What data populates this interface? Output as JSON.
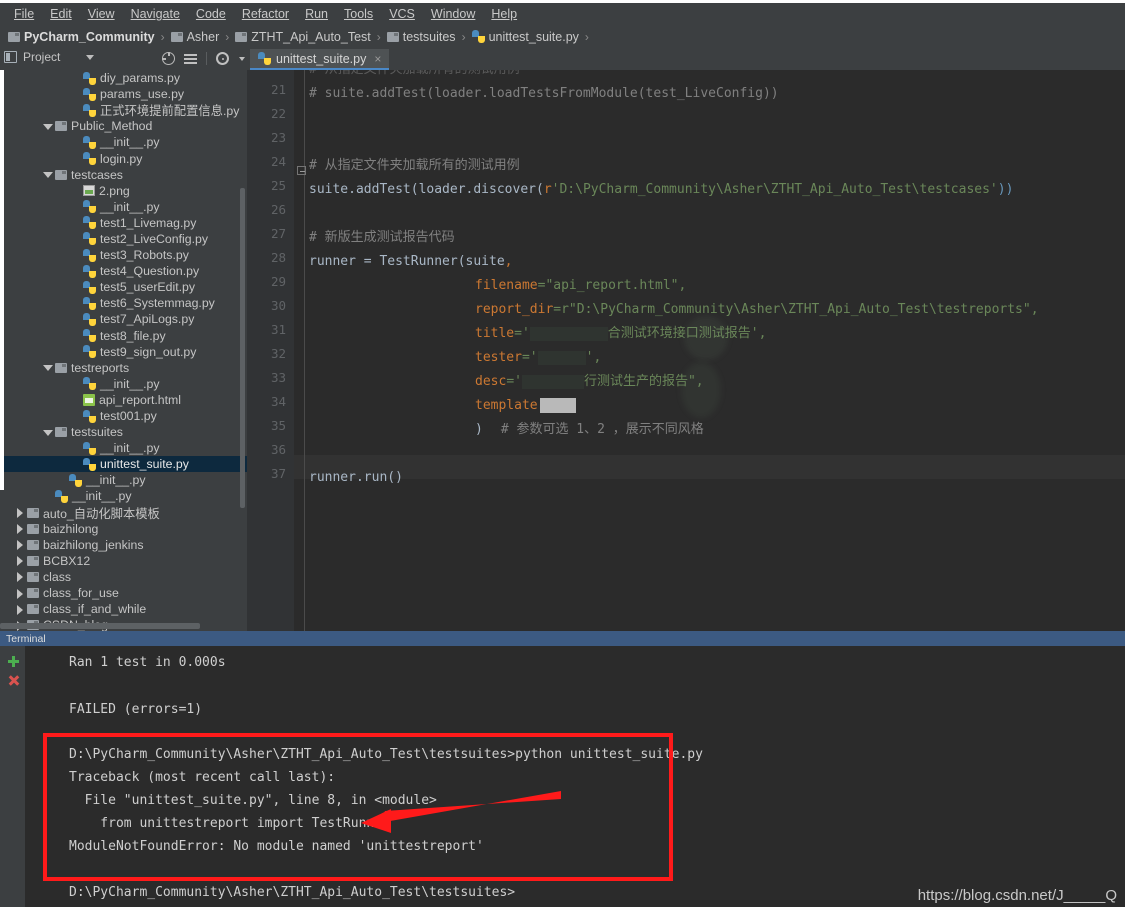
{
  "window": {
    "menu": [
      "File",
      "Edit",
      "View",
      "Navigate",
      "Code",
      "Refactor",
      "Run",
      "Tools",
      "VCS",
      "Window",
      "Help"
    ],
    "breadcrumb": [
      {
        "label": "PyCharm_Community",
        "icon": "folder-icon"
      },
      {
        "label": "Asher",
        "icon": "folder-icon"
      },
      {
        "label": "ZTHT_Api_Auto_Test",
        "icon": "folder-icon"
      },
      {
        "label": "testsuites",
        "icon": "folder-icon"
      },
      {
        "label": "unittest_suite.py",
        "icon": "python-file-icon"
      }
    ],
    "separator": "›"
  },
  "toolwindow": {
    "project_label": "Project",
    "icons": [
      "target-icon",
      "collapse-all-icon",
      "gear-icon",
      "hide-icon"
    ]
  },
  "editor_tab": {
    "label": "unittest_suite.py",
    "close": "×",
    "icon": "python-file-icon"
  },
  "tree": {
    "items": [
      {
        "label": "diy_params.py",
        "icon": "python-file-icon",
        "indent": 5,
        "arrow": "none",
        "selected": false
      },
      {
        "label": "params_use.py",
        "icon": "python-file-icon",
        "indent": 5,
        "arrow": "none",
        "selected": false
      },
      {
        "label": "正式环境提前配置信息.py",
        "icon": "python-file-icon",
        "indent": 5,
        "arrow": "none",
        "selected": false
      },
      {
        "label": "Public_Method",
        "icon": "folder-icon",
        "indent": 3,
        "arrow": "down",
        "selected": false
      },
      {
        "label": "__init__.py",
        "icon": "python-file-icon",
        "indent": 5,
        "arrow": "none",
        "selected": false
      },
      {
        "label": "login.py",
        "icon": "python-file-icon",
        "indent": 5,
        "arrow": "none",
        "selected": false
      },
      {
        "label": "testcases",
        "icon": "folder-icon",
        "indent": 3,
        "arrow": "down",
        "selected": false
      },
      {
        "label": "2.png",
        "icon": "image-file-icon",
        "indent": 5,
        "arrow": "none",
        "selected": false
      },
      {
        "label": "__init__.py",
        "icon": "python-file-icon",
        "indent": 5,
        "arrow": "none",
        "selected": false
      },
      {
        "label": "test1_Livemag.py",
        "icon": "python-file-icon",
        "indent": 5,
        "arrow": "none",
        "selected": false
      },
      {
        "label": "test2_LiveConfig.py",
        "icon": "python-file-icon",
        "indent": 5,
        "arrow": "none",
        "selected": false
      },
      {
        "label": "test3_Robots.py",
        "icon": "python-file-icon",
        "indent": 5,
        "arrow": "none",
        "selected": false
      },
      {
        "label": "test4_Question.py",
        "icon": "python-file-icon",
        "indent": 5,
        "arrow": "none",
        "selected": false
      },
      {
        "label": "test5_userEdit.py",
        "icon": "python-file-icon",
        "indent": 5,
        "arrow": "none",
        "selected": false
      },
      {
        "label": "test6_Systemmag.py",
        "icon": "python-file-icon",
        "indent": 5,
        "arrow": "none",
        "selected": false
      },
      {
        "label": "test7_ApiLogs.py",
        "icon": "python-file-icon",
        "indent": 5,
        "arrow": "none",
        "selected": false
      },
      {
        "label": "test8_file.py",
        "icon": "python-file-icon",
        "indent": 5,
        "arrow": "none",
        "selected": false
      },
      {
        "label": "test9_sign_out.py",
        "icon": "python-file-icon",
        "indent": 5,
        "arrow": "none",
        "selected": false
      },
      {
        "label": "testreports",
        "icon": "folder-icon",
        "indent": 3,
        "arrow": "down",
        "selected": false
      },
      {
        "label": "__init__.py",
        "icon": "python-file-icon",
        "indent": 5,
        "arrow": "none",
        "selected": false
      },
      {
        "label": "api_report.html",
        "icon": "html-file-icon",
        "indent": 5,
        "arrow": "none",
        "selected": false
      },
      {
        "label": "test001.py",
        "icon": "python-file-icon",
        "indent": 5,
        "arrow": "none",
        "selected": false
      },
      {
        "label": "testsuites",
        "icon": "folder-icon",
        "indent": 3,
        "arrow": "down",
        "selected": false
      },
      {
        "label": "__init__.py",
        "icon": "python-file-icon",
        "indent": 5,
        "arrow": "none",
        "selected": false
      },
      {
        "label": "unittest_suite.py",
        "icon": "python-file-icon",
        "indent": 5,
        "arrow": "none",
        "selected": true
      },
      {
        "label": "__init__.py",
        "icon": "python-file-icon",
        "indent": 4,
        "arrow": "none",
        "selected": false
      },
      {
        "label": "__init__.py",
        "icon": "python-file-icon",
        "indent": 3,
        "arrow": "none",
        "selected": false
      },
      {
        "label": "auto_自动化脚本模板",
        "icon": "folder-icon",
        "indent": 1,
        "arrow": "right",
        "selected": false
      },
      {
        "label": "baizhilong",
        "icon": "folder-icon",
        "indent": 1,
        "arrow": "right",
        "selected": false
      },
      {
        "label": "baizhilong_jenkins",
        "icon": "folder-icon",
        "indent": 1,
        "arrow": "right",
        "selected": false
      },
      {
        "label": "BCBX12",
        "icon": "folder-icon",
        "indent": 1,
        "arrow": "right",
        "selected": false
      },
      {
        "label": "class",
        "icon": "folder-icon",
        "indent": 1,
        "arrow": "right",
        "selected": false
      },
      {
        "label": "class_for_use",
        "icon": "folder-icon",
        "indent": 1,
        "arrow": "right",
        "selected": false
      },
      {
        "label": "class_if_and_while",
        "icon": "folder-icon",
        "indent": 1,
        "arrow": "right",
        "selected": false
      },
      {
        "label": "CSDN_blog",
        "icon": "folder-icon",
        "indent": 1,
        "arrow": "right",
        "selected": false
      }
    ]
  },
  "code": {
    "first_line_number": 21,
    "last_line_number": 37,
    "line_numbers": [
      21,
      22,
      23,
      24,
      25,
      26,
      27,
      28,
      29,
      30,
      31,
      32,
      33,
      34,
      35,
      36,
      37
    ],
    "lines": {
      "l21": "# suite.addTest(loader.loadTestsFromModule(test_LiveConfig))",
      "l24": "# 从指定文件夹加载所有的测试用例",
      "l25_a": "suite.addTest(loader.discover(",
      "l25_r": "r",
      "l25_str": "'D:\\PyCharm_Community\\Asher\\ZTHT_Api_Auto_Test\\testcases'",
      "l25_b": "))",
      "l27": "# 新版生成测试报告代码",
      "l28_a": "runner = TestRunner(suite",
      "l28_b": ",",
      "l29_k": "filename",
      "l29_v": "=\"api_report.html\",",
      "l30_k": "report_dir",
      "l30_v": "=r\"D:\\PyCharm_Community\\Asher\\ZTHT_Api_Auto_Test\\testreports\",",
      "l31_k": "title",
      "l31_v_pre": "='",
      "l31_v_post": "合测试环境接口测试报告',",
      "l32_k": "tester",
      "l32_v_pre": "='",
      "l32_v_post": "',",
      "l33_k": "desc",
      "l33_v_pre": "='",
      "l33_v_post": "行测试生产的报告\",",
      "l34_k": "template",
      "l35_a": ")",
      "l35_b": "# 参数可选 1、2 ，展示不同风格",
      "l37": "runner.run()"
    }
  },
  "terminal": {
    "title": "Terminal",
    "new_session_icon": "plus-icon",
    "close_session_icon": "close-icon",
    "lines": [
      "Ran 1 test in 0.000s",
      "",
      "FAILED (errors=1)",
      "",
      "",
      "D:\\PyCharm_Community\\Asher\\ZTHT_Api_Auto_Test\\testsuites>python unittest_suite.py",
      "Traceback (most recent call last):",
      "  File \"unittest_suite.py\", line 8, in <module>",
      "    from unittestreport import TestRunner",
      "ModuleNotFoundError: No module named 'unittestreport'",
      "",
      "D:\\PyCharm_Community\\Asher\\ZTHT_Api_Auto_Test\\testsuites>"
    ]
  },
  "annotations": {
    "highlight_color": "#ff1a1a",
    "arrow_color": "#ff1a1a",
    "box_name": "error-highlight-box",
    "arrow_name": "error-pointer-arrow"
  },
  "watermark": {
    "text": "https://blog.csdn.net/J_____Q"
  },
  "colors": {
    "chrome": "#3c3f41",
    "editor_bg": "#2b2b2b",
    "gutter_bg": "#313335",
    "selection": "#0d293e",
    "tab_underline": "#4a88c7",
    "terminal_header": "#3c5a82",
    "comment": "#808080",
    "string": "#6a8759",
    "keyword": "#cc7832",
    "text": "#a9b7c6"
  }
}
